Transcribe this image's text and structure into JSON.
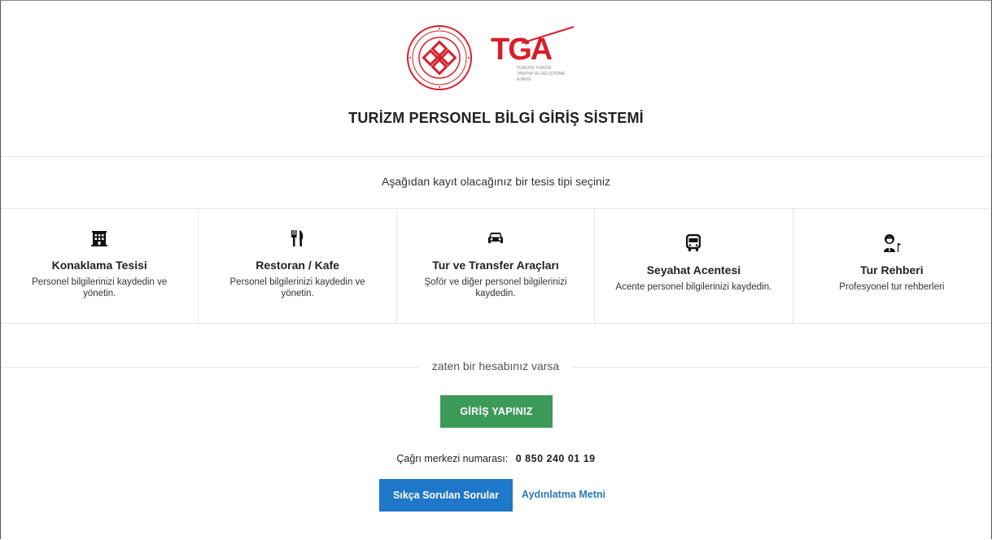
{
  "header": {
    "title": "TURİZM PERSONEL BİLGİ GİRİŞ SİSTEMİ",
    "tga_logo_text": "TGA",
    "tga_logo_caption": "TÜRKİYE TURİZM TANITIM VE GELİŞTİRME AJANSI",
    "brand_red": "#d81f2a"
  },
  "subtitle": "Aşağıdan kayıt olacağınız bir tesis tipi seçiniz",
  "cards": [
    {
      "icon": "building-icon",
      "name": "Konaklama Tesisi",
      "desc": "Personel bilgilerinizi kaydedin ve yönetin."
    },
    {
      "icon": "fork-knife-icon",
      "name": "Restoran / Kafe",
      "desc": "Personel bilgilerinizi kaydedin ve yönetin."
    },
    {
      "icon": "car-icon",
      "name": "Tur ve Transfer Araçları",
      "desc": "Şoför ve diğer personel bilgilerinizi kaydedin."
    },
    {
      "icon": "bus-icon",
      "name": "Seyahat Acentesi",
      "desc": "Acente personel bilgilerinizi kaydedin."
    },
    {
      "icon": "tour-guide-icon",
      "name": "Tur Rehberi",
      "desc": "Profesyonel tur rehberleri"
    }
  ],
  "account_divider": "zaten bir hesabınız varsa",
  "login_button": "GİRİŞ YAPINIZ",
  "call_center": {
    "label": "Çağrı merkezi numarası:",
    "number": "0 850 240 01 19"
  },
  "faq_button": "Sıkça Sorulan Sorular",
  "disclosure_link": "Aydınlatma Metni",
  "colors": {
    "login_green": "#3c9a59",
    "faq_blue": "#1f77c9",
    "link_blue": "#2a7ab8"
  }
}
